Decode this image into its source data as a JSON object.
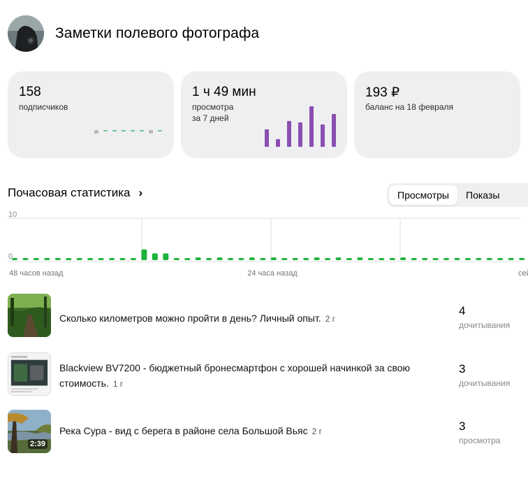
{
  "channel": {
    "title": "Заметки полевого фотографа"
  },
  "cards": {
    "subscribers": {
      "value": "158",
      "label": "подписчиков"
    },
    "watchtime": {
      "value": "1 ч 49 мин",
      "label_line1": "просмотра",
      "label_line2": "за 7 дней",
      "bars": [
        25,
        11,
        37,
        35,
        58,
        32,
        47
      ]
    },
    "balance": {
      "value": "193 ₽",
      "label": "баланс на 18 февраля"
    }
  },
  "hourly": {
    "title": "Почасовая статистика",
    "toggle": {
      "active": "Просмотры",
      "inactive": "Показы"
    },
    "ymax_label": "10",
    "ymin_label": "0",
    "x_labels": [
      "48 часов назад",
      "24 часа назад",
      "сейчас"
    ],
    "values": [
      0.2,
      0.2,
      0.2,
      0.2,
      0.2,
      0.2,
      0.2,
      0.2,
      0.2,
      0.2,
      0.2,
      0.2,
      1.6,
      1.0,
      1.0,
      0.2,
      0.2,
      0.4,
      0.2,
      0.4,
      0.2,
      0.2,
      0.4,
      0.2,
      0.4,
      0.2,
      0.2,
      0.2,
      0.4,
      0.2,
      0.4,
      0.2,
      0.4,
      0.2,
      0.2,
      0.2,
      0.4,
      0.2,
      0.2,
      0.2,
      0.2,
      0.2,
      0.2,
      0.2,
      0.2,
      0.2,
      0.2,
      0.2,
      0.8,
      0.9,
      0.2,
      0.2,
      0.2,
      0.2,
      0.2,
      0.2,
      0.2
    ],
    "colors": {
      "bar": "#1db33c",
      "bar_light": "#8fd8a0",
      "grid": "#dcdcdc"
    }
  },
  "articles": [
    {
      "title": "Сколько километров можно пройти в день? Личный опыт.",
      "age": "2 г",
      "count": "4",
      "metric": "дочитывания",
      "thumb": "forest-path"
    },
    {
      "title_line1": "Blackview BV7200 - бюджетный бронесмартфон с хорошей начинкой за свою",
      "title_line2": "стоимость.",
      "age": "1 г",
      "count": "3",
      "metric": "дочитывания",
      "thumb": "phone-review"
    },
    {
      "title": "Река Сура - вид с берега в районе села Большой Вьяс",
      "age": "2 г",
      "count": "3",
      "metric": "просмотра",
      "thumb": "river",
      "duration": "2:39"
    }
  ],
  "colors": {
    "card_bg": "#efeff1",
    "accent_purple": "#8a4fb0",
    "dash_green": "#6ec48a",
    "dash_gray": "#b9b9b9"
  }
}
